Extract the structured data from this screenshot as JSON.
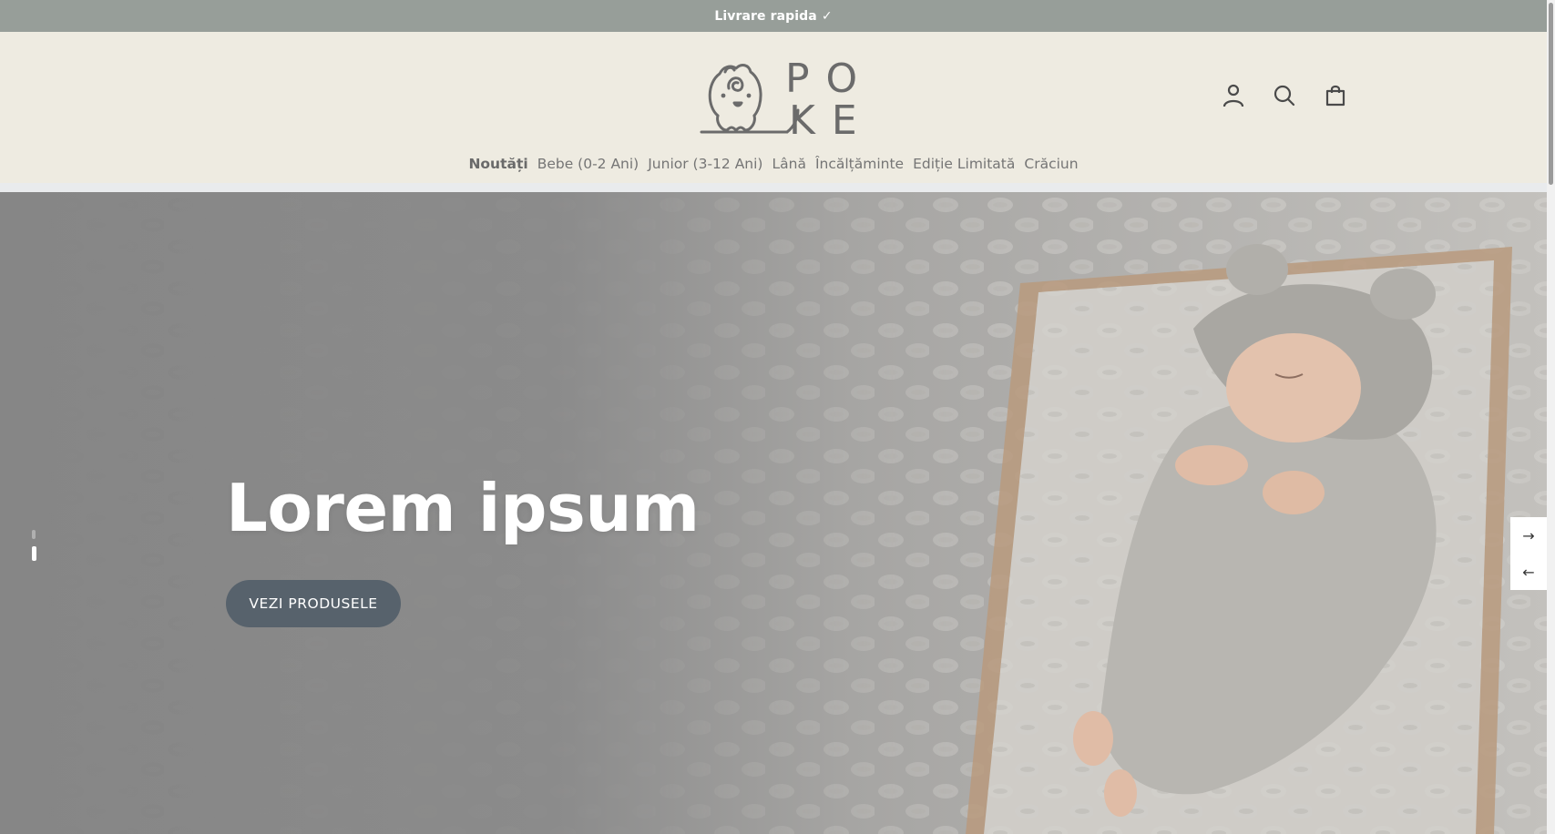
{
  "announcement": {
    "text": "Livrare rapida ✓"
  },
  "brand": {
    "name_line1": "PO",
    "name_line2": "KE"
  },
  "header_icons": [
    "account-icon",
    "search-icon",
    "cart-icon"
  ],
  "nav": {
    "items": [
      {
        "label": "Noutăți",
        "active": true
      },
      {
        "label": "Bebe (0-2 Ani)",
        "active": false
      },
      {
        "label": "Junior (3-12 Ani)",
        "active": false
      },
      {
        "label": "Lână",
        "active": false
      },
      {
        "label": "Încălțăminte",
        "active": false
      },
      {
        "label": "Ediție Limitată",
        "active": false
      },
      {
        "label": "Crăciun",
        "active": false
      }
    ]
  },
  "hero": {
    "title": "Lorem ipsum",
    "cta_label": "VEZI PRODUSELE",
    "next_arrow": "→",
    "prev_arrow": "←"
  },
  "colors": {
    "announcement_bg": "#979e99",
    "header_bg": "#eeebe1",
    "cta_bg": "#57626c",
    "hero_overlay": "#8a8a8a"
  }
}
